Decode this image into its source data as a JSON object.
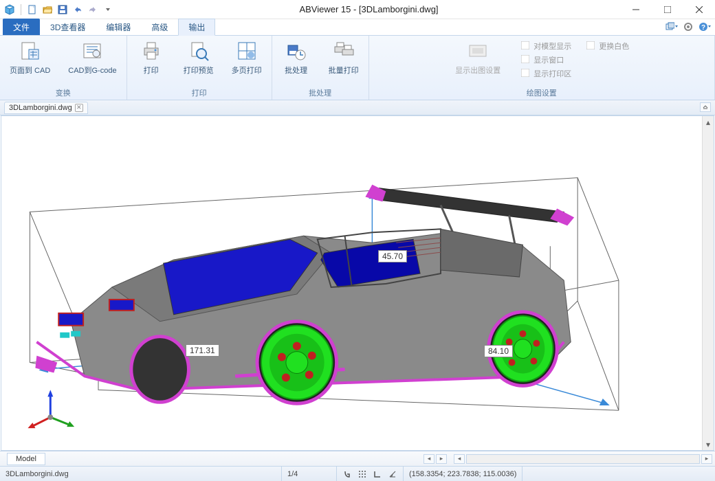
{
  "title": "ABViewer 15 - [3DLamborgini.dwg]",
  "qat": {
    "app_icon": "cube",
    "new": "new",
    "open": "open",
    "save": "save",
    "undo": "undo",
    "redo": "redo"
  },
  "tabs": {
    "file": "文件",
    "items": [
      "3D查看器",
      "编辑器",
      "高级",
      "输出"
    ],
    "active": "输出"
  },
  "ribbon": {
    "groups": [
      {
        "title": "变换",
        "buttons": [
          {
            "id": "page-to-cad",
            "label": "页面到 CAD"
          },
          {
            "id": "cad-to-gcode",
            "label": "CAD到G-code"
          }
        ]
      },
      {
        "title": "打印",
        "buttons": [
          {
            "id": "print",
            "label": "打印"
          },
          {
            "id": "print-preview",
            "label": "打印预览"
          },
          {
            "id": "multipage-print",
            "label": "多页打印"
          }
        ]
      },
      {
        "title": "批处理",
        "buttons": [
          {
            "id": "batch",
            "label": "批处理"
          },
          {
            "id": "batch-print",
            "label": "批量打印"
          }
        ]
      },
      {
        "title": "绘图设置",
        "buttons": [
          {
            "id": "plot-settings",
            "label": "显示出图设置",
            "disabled": true
          }
        ],
        "small": [
          {
            "id": "show-model",
            "label": "对模型显示"
          },
          {
            "id": "swap-white",
            "label": "更换白色"
          },
          {
            "id": "show-window",
            "label": "显示窗口"
          },
          {
            "id": "show-plot-area",
            "label": "显示打印区"
          }
        ]
      }
    ]
  },
  "doctab": {
    "name": "3DLamborgini.dwg"
  },
  "dimensions": {
    "height": "45.70",
    "length": "171.31",
    "width": "84.10"
  },
  "bottom": {
    "model_tab": "Model"
  },
  "status": {
    "filename": "3DLamborgini.dwg",
    "page": "1/4",
    "coords": "(158.3354; 223.7838; 115.0036)"
  }
}
